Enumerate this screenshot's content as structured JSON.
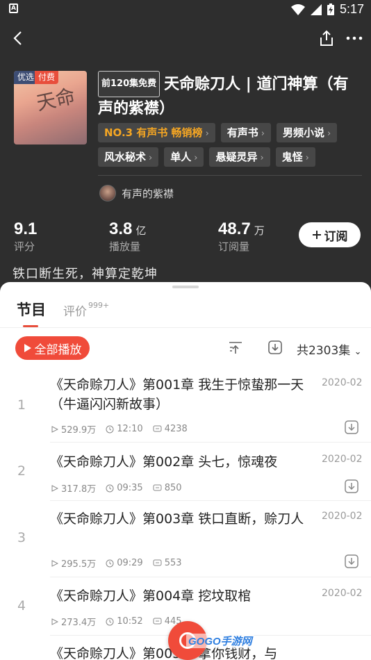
{
  "status": {
    "time": "5:17"
  },
  "book": {
    "badge_1": "优选",
    "badge_2": "付费",
    "free_tag": "前120集免费",
    "title": "天命赊刀人 | 道门神算（有声的紫襟）",
    "tags_row1": [
      {
        "label": "NO.3 有声书 畅销榜",
        "rank": true
      },
      {
        "label": "有声书"
      },
      {
        "label": "男频小说"
      }
    ],
    "tags_row2": [
      {
        "label": "风水秘术"
      },
      {
        "label": "单人"
      },
      {
        "label": "悬疑灵异"
      },
      {
        "label": "鬼怪"
      }
    ],
    "author": "有声的紫襟",
    "stats": {
      "rating": {
        "num": "9.1",
        "unit": "",
        "label": "评分"
      },
      "plays": {
        "num": "3.8",
        "unit": "亿",
        "label": "播放量"
      },
      "subs": {
        "num": "48.7",
        "unit": "万",
        "label": "订阅量"
      }
    },
    "subscribe_label": "订阅",
    "slogan": "铁口断生死，神算定乾坤"
  },
  "sheet": {
    "tab_main": "节目",
    "tab_review": "评价",
    "review_count": "999+",
    "play_all": "全部播放",
    "total": "共2303集"
  },
  "episodes": [
    {
      "num": "1",
      "title": "《天命赊刀人》第001章 我生于惊蛰那一天（牛逼闪闪新故事）",
      "date": "2020-02",
      "plays": "529.9万",
      "duration": "12:10",
      "comments": "4238"
    },
    {
      "num": "2",
      "title": "《天命赊刀人》第002章 头七，惊魂夜",
      "date": "2020-02",
      "plays": "317.8万",
      "duration": "09:35",
      "comments": "850"
    },
    {
      "num": "3",
      "title": "《天命赊刀人》第003章 铁口直断，赊刀人",
      "date": "2020-02",
      "plays": "295.5万",
      "duration": "09:29",
      "comments": "553"
    },
    {
      "num": "4",
      "title": "《天命赊刀人》第004章 挖坟取棺",
      "date": "2020-02",
      "plays": "273.4万",
      "duration": "10:52",
      "comments": "445"
    },
    {
      "num": "",
      "title": "《天命赊刀人》第005章 拿你钱财，与",
      "date": "",
      "plays": "",
      "duration": "",
      "comments": ""
    }
  ],
  "watermark": "GOGO手游网",
  "colors": {
    "accent": "#f04b3a",
    "rank": "#f5a623",
    "header_bg": "#2e2e2e"
  }
}
